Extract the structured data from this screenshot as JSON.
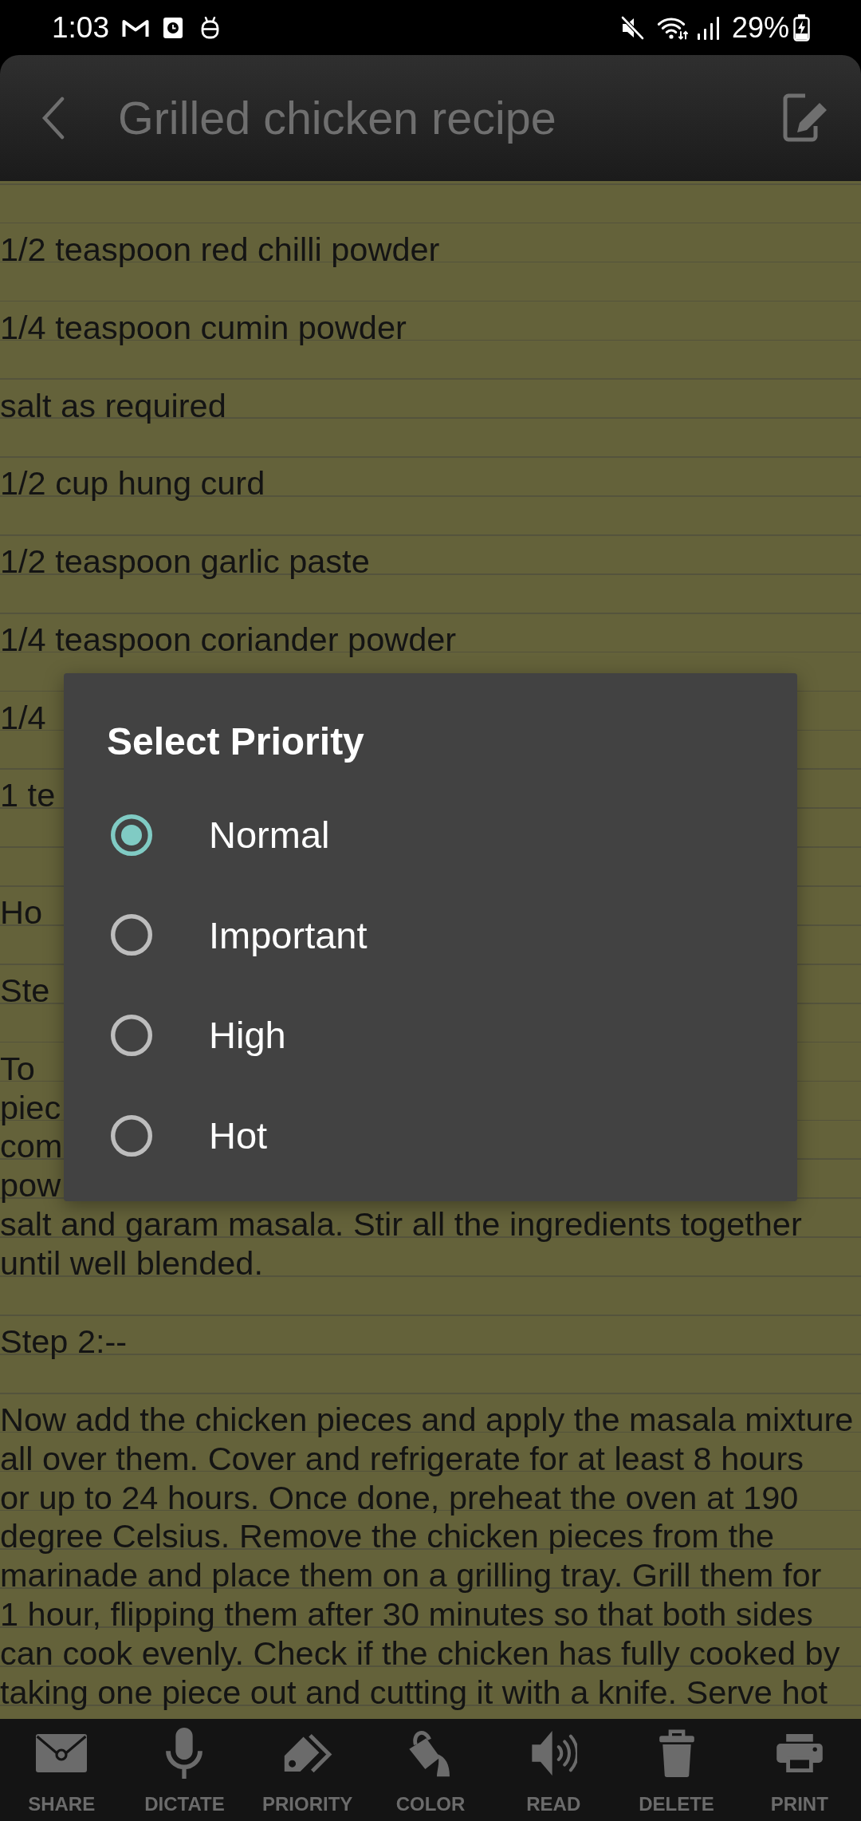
{
  "status_bar": {
    "time": "1:03",
    "battery": "29%"
  },
  "header": {
    "title": "Grilled chicken recipe"
  },
  "note": {
    "blocks": [
      {
        "kind": "blank"
      },
      {
        "kind": "line",
        "text": "1/2 teaspoon red chilli powder"
      },
      {
        "kind": "blank"
      },
      {
        "kind": "line",
        "text": "1/4 teaspoon cumin powder"
      },
      {
        "kind": "blank"
      },
      {
        "kind": "line",
        "text": "salt as required"
      },
      {
        "kind": "blank"
      },
      {
        "kind": "line",
        "text": "1/2 cup hung curd"
      },
      {
        "kind": "blank"
      },
      {
        "kind": "line",
        "text": "1/2 teaspoon garlic paste"
      },
      {
        "kind": "blank"
      },
      {
        "kind": "line",
        "text": "1/4 teaspoon coriander powder"
      },
      {
        "kind": "blank"
      },
      {
        "kind": "line",
        "text": "1/4"
      },
      {
        "kind": "blank"
      },
      {
        "kind": "line",
        "text": "1 te"
      },
      {
        "kind": "blank"
      },
      {
        "kind": "blank"
      },
      {
        "kind": "line",
        "text": "Ho"
      },
      {
        "kind": "blank"
      },
      {
        "kind": "line",
        "text": "Ste"
      },
      {
        "kind": "blank"
      },
      {
        "kind": "line",
        "text": "To"
      },
      {
        "kind": "line",
        "text": "piec"
      },
      {
        "kind": "line",
        "text": "com"
      },
      {
        "kind": "line",
        "text": "pow"
      },
      {
        "kind": "paragraph",
        "lines": [
          "salt and garam masala. Stir all the ingredients together",
          "until well blended."
        ]
      },
      {
        "kind": "blank"
      },
      {
        "kind": "line",
        "text": "Step 2:--"
      },
      {
        "kind": "blank"
      },
      {
        "kind": "paragraph",
        "lines": [
          "Now add the chicken pieces and apply the masala mixture",
          "all over them. Cover and refrigerate for at least 8 hours",
          "or up to 24 hours. Once done, preheat the oven at 190",
          "degree Celsius. Remove the chicken pieces from the",
          "marinade and place them on a grilling tray. Grill them for",
          "1 hour, flipping them after 30 minutes so that both sides",
          "can cook evenly. Check if the chicken has fully cooked by",
          "taking one piece out and cutting it with a knife. Serve hot"
        ]
      }
    ]
  },
  "dialog": {
    "title": "Select Priority",
    "options": [
      {
        "label": "Normal",
        "selected": true
      },
      {
        "label": "Important",
        "selected": false
      },
      {
        "label": "High",
        "selected": false
      },
      {
        "label": "Hot",
        "selected": false
      }
    ]
  },
  "toolbar": [
    {
      "kind": "share",
      "label": "SHARE"
    },
    {
      "kind": "dictate",
      "label": "DICTATE"
    },
    {
      "kind": "priority",
      "label": "PRIORITY"
    },
    {
      "kind": "color",
      "label": "COLOR"
    },
    {
      "kind": "read",
      "label": "READ"
    },
    {
      "kind": "delete",
      "label": "DELETE"
    },
    {
      "kind": "print",
      "label": "PRINT"
    }
  ]
}
